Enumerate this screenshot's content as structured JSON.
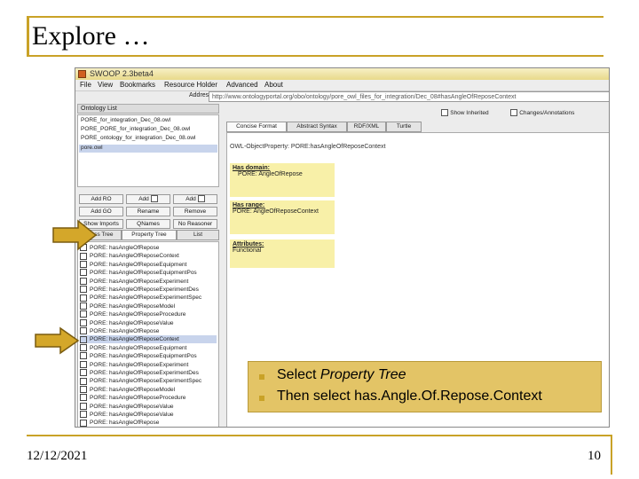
{
  "slide": {
    "title": "Explore …",
    "date": "12/12/2021",
    "page_number": "10"
  },
  "window": {
    "title": "SWOOP 2.3beta4",
    "menus": [
      "File",
      "View",
      "Bookmarks",
      "Resource Holder",
      "Advanced",
      "About"
    ],
    "address_label": "Address:",
    "address": "http://www.ontologyportal.org/obo/ontology/pore_owl_files_for_integration/Dec_08#hasAngleOfReposeContext",
    "ontology_panel_label": "Ontology List",
    "ontologies": [
      "PORE_for_integration_Dec_08.owl",
      "PORE_PORE_for_integration_Dec_08.owl",
      "PORE_ontology_for_integration_Dec_08.owl",
      "pore.owl"
    ],
    "buttons": {
      "add_ro": "Add RO",
      "add": "Add",
      "add2": "Add",
      "add_go": "Add GO",
      "rename": "Rename",
      "remove": "Remove"
    },
    "filters": [
      "Show Imports",
      "QNames",
      "No Reasoner"
    ],
    "tree_tabs": [
      "Class Tree",
      "Property Tree",
      "List"
    ],
    "tree_items": [
      "PORE: hasAngleOfRepose",
      "PORE: hasAngleOfReposeContext",
      "PORE: hasAngleOfReposeEquipment",
      "PORE: hasAngleOfReposeEquipmentPos",
      "PORE: hasAngleOfReposeExperiment",
      "PORE: hasAngleOfReposeExperimentDes",
      "PORE: hasAngleOfReposeExperimentSpec",
      "PORE: hasAngleOfReposeModel",
      "PORE: hasAngleOfReposeProcedure",
      "PORE: hasAngleOfReposeValue",
      "PORE: hasAngleOfRepose",
      "PORE: hasAngleOfReposeContext",
      "PORE: hasAngleOfReposeEquipment",
      "PORE: hasAngleOfReposeEquipmentPos",
      "PORE: hasAngleOfReposeExperiment",
      "PORE: hasAngleOfReposeExperimentDes",
      "PORE: hasAngleOfReposeExperimentSpec",
      "PORE: hasAngleOfReposeModel",
      "PORE: hasAngleOfReposeProcedure",
      "PORE: hasAngleOfReposeValue",
      "PORE: hasAngleOfReposeValue",
      "PORE: hasAngleOfRepose"
    ],
    "right_tools": [
      "Show Inherited",
      "Changes/Annotations"
    ],
    "right_tabs": [
      "Concise Format",
      "Abstract Syntax",
      "RDF/XML",
      "Turtle"
    ],
    "property_header": "OWL-ObjectProperty: PORE:hasAngleOfReposeContext",
    "domain_label": "Has domain:",
    "domain_value": "PORE: AngleOfRepose",
    "range_label": "Has range:",
    "range_value": "PORE: AngleOfReposeContext",
    "attributes_label": "Attributes:",
    "attributes_value": "Functional"
  },
  "callout": {
    "line1_prefix": "Select ",
    "line1_italic": "Property Tree",
    "line2": "Then select has.Angle.Of.Repose.Context"
  },
  "colors": {
    "accent": "#c9a227",
    "callout_bg": "#e3c466",
    "highlight_yellow": "#f8f0a8"
  }
}
